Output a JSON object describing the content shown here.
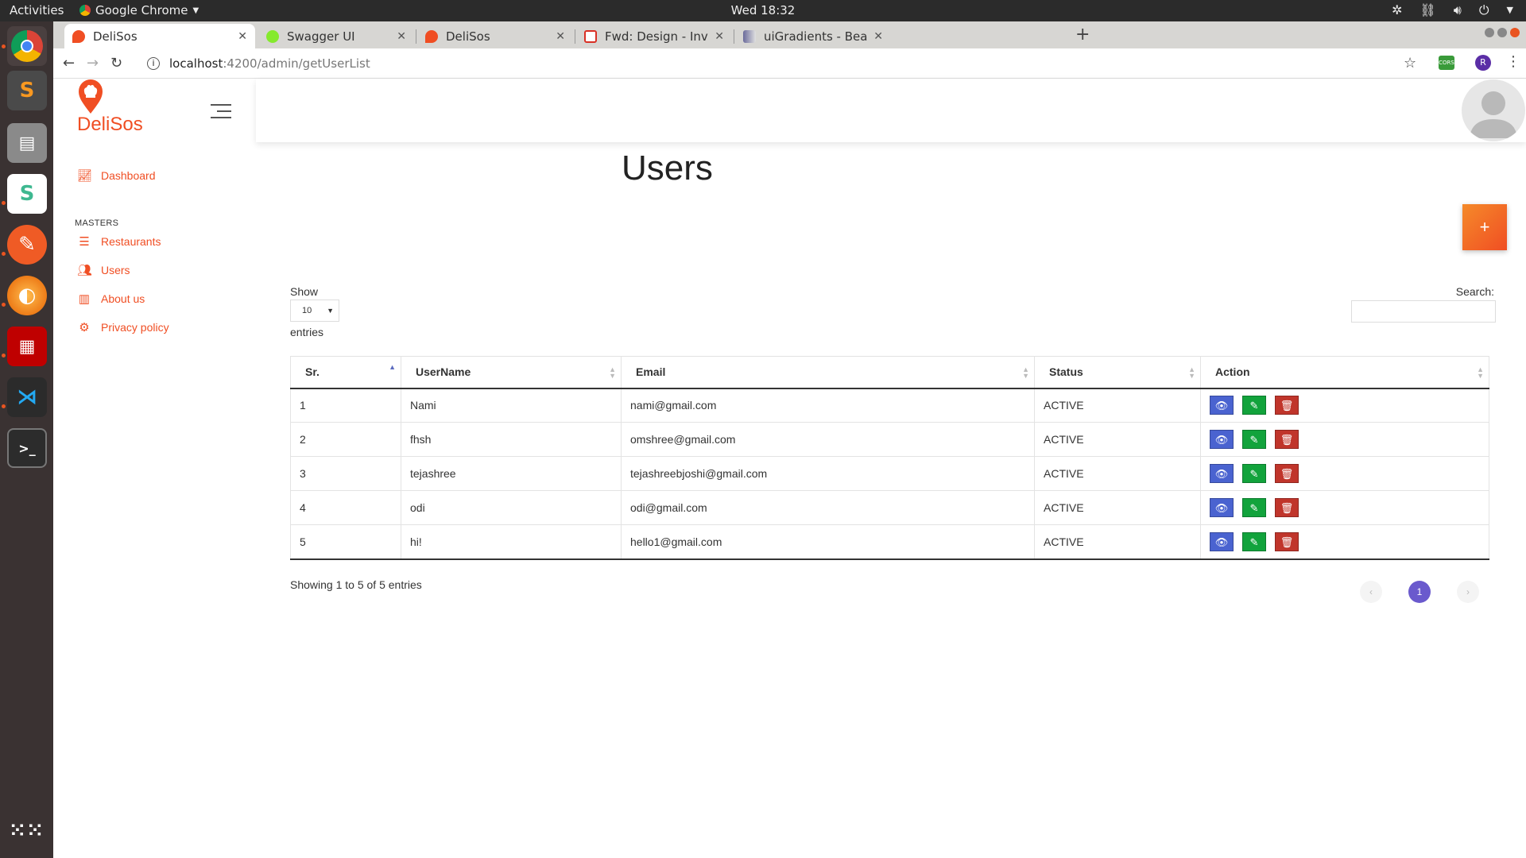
{
  "os": {
    "activities": "Activities",
    "app_name": "Google Chrome",
    "clock": "Wed 18:32"
  },
  "browser": {
    "tabs": [
      {
        "title": "DeliSos",
        "active": true,
        "color": "#f04e23"
      },
      {
        "title": "Swagger UI",
        "active": false,
        "color": "#85ea2d"
      },
      {
        "title": "DeliSos",
        "active": false,
        "color": "#f04e23"
      },
      {
        "title": "Fwd: Design - Invitation to",
        "active": false,
        "color": "#d93025"
      },
      {
        "title": "uiGradients - Beautiful co",
        "active": false,
        "color": "#6b6b9b"
      }
    ],
    "url_host": "localhost",
    "url_path": ":4200/admin/getUserList",
    "profile_initial": "R",
    "ext_label": "CORS"
  },
  "app": {
    "logo": "DeliSos",
    "nav": {
      "dashboard": "Dashboard",
      "masters_heading": "MASTERS",
      "restaurants": "Restaurants",
      "users": "Users",
      "about": "About us",
      "privacy": "Privacy policy"
    },
    "page_title": "Users",
    "add_button": "+",
    "table_controls": {
      "show": "Show",
      "length": "10",
      "entries": "entries",
      "search": "Search:"
    },
    "columns": [
      "Sr.",
      "UserName",
      "Email",
      "Status",
      "Action"
    ],
    "rows": [
      {
        "sr": "1",
        "username": "Nami",
        "email": "nami@gmail.com",
        "status": "ACTIVE"
      },
      {
        "sr": "2",
        "username": "fhsh",
        "email": "omshree@gmail.com",
        "status": "ACTIVE"
      },
      {
        "sr": "3",
        "username": "tejashree",
        "email": "tejashreebjoshi@gmail.com",
        "status": "ACTIVE"
      },
      {
        "sr": "4",
        "username": "odi",
        "email": "odi@gmail.com",
        "status": "ACTIVE"
      },
      {
        "sr": "5",
        "username": "hi!",
        "email": "hello1@gmail.com",
        "status": "ACTIVE"
      }
    ],
    "info": "Showing 1 to 5 of 5 entries",
    "pagination": {
      "prev": "‹",
      "current": "1",
      "next": "›"
    },
    "colors": {
      "brand": "#f04e23",
      "view": "#4a63d0",
      "edit": "#12a33c",
      "delete": "#c0352b",
      "page_active": "#6a5acd"
    }
  }
}
